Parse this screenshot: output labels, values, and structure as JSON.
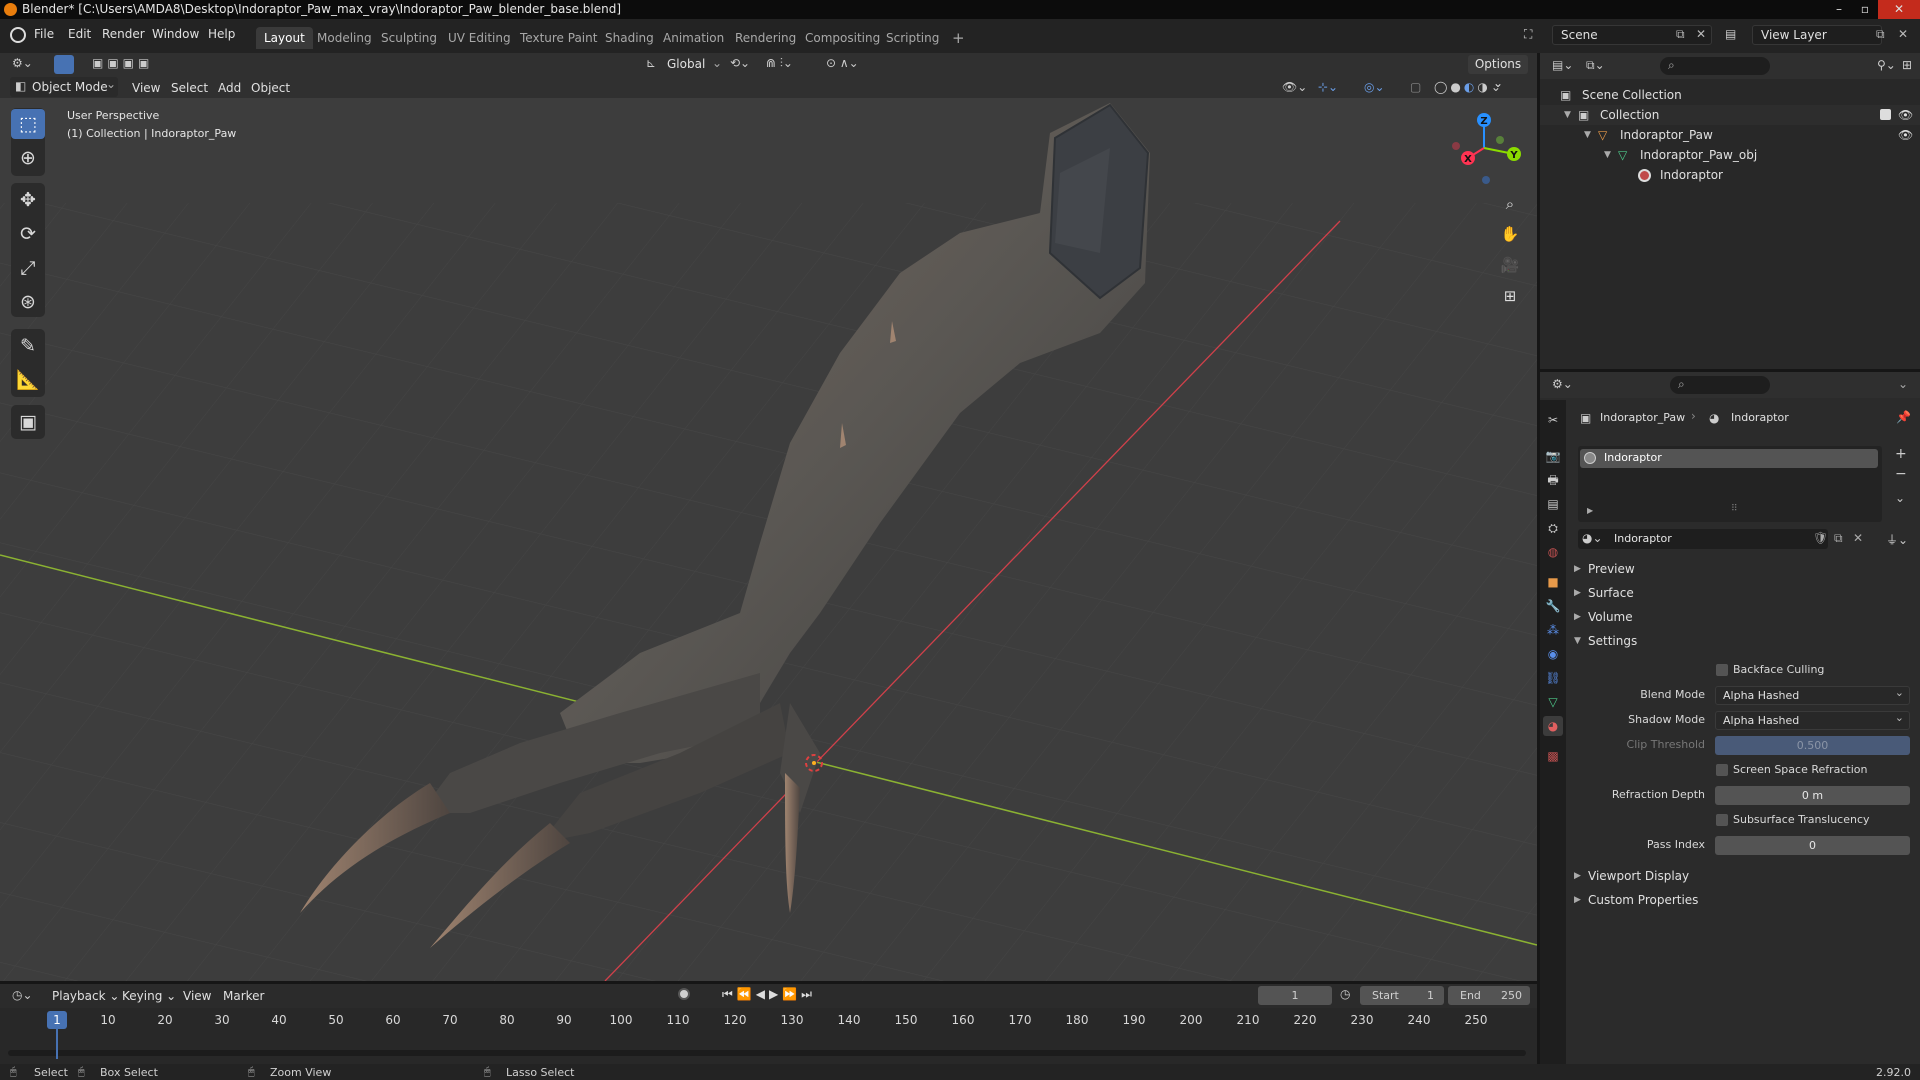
{
  "window": {
    "title": "Blender* [C:\\Users\\AMDA8\\Desktop\\Indoraptor_Paw_max_vray\\Indoraptor_Paw_blender_base.blend]"
  },
  "menu": [
    "File",
    "Edit",
    "Render",
    "Window",
    "Help"
  ],
  "workspaces": [
    "Layout",
    "Modeling",
    "Sculpting",
    "UV Editing",
    "Texture Paint",
    "Shading",
    "Animation",
    "Rendering",
    "Compositing",
    "Scripting"
  ],
  "active_workspace": "Layout",
  "scene": {
    "name": "Scene",
    "view_layer": "View Layer"
  },
  "viewport": {
    "mode": "Object Mode",
    "menus": [
      "View",
      "Select",
      "Add",
      "Object"
    ],
    "transform_orientation": "Global",
    "options_label": "Options",
    "perspective_label": "User Perspective",
    "collection_label": "(1) Collection | Indoraptor_Paw",
    "gizmo_axes": {
      "x": "X",
      "y": "Y",
      "z": "Z"
    }
  },
  "outliner": {
    "rows": [
      "Scene Collection",
      "Collection",
      "Indoraptor_Paw",
      "Indoraptor_Paw_obj",
      "Indoraptor"
    ]
  },
  "properties": {
    "breadcrumb_object": "Indoraptor_Paw",
    "breadcrumb_material": "Indoraptor",
    "slot_name": "Indoraptor",
    "material_name": "Indoraptor",
    "panels": [
      "Preview",
      "Surface",
      "Volume",
      "Settings",
      "Viewport Display",
      "Custom Properties"
    ],
    "settings": {
      "backface_culling_label": "Backface Culling",
      "blend_mode_label": "Blend Mode",
      "blend_mode": "Alpha Hashed",
      "shadow_mode_label": "Shadow Mode",
      "shadow_mode": "Alpha Hashed",
      "clip_threshold_label": "Clip Threshold",
      "clip_threshold": "0.500",
      "ssr_label": "Screen Space Refraction",
      "refraction_depth_label": "Refraction Depth",
      "refraction_depth": "0 m",
      "subsurface_label": "Subsurface Translucency",
      "pass_index_label": "Pass Index",
      "pass_index": "0"
    }
  },
  "timeline": {
    "menus": [
      "Playback",
      "Keying",
      "View",
      "Marker"
    ],
    "current_frame": "1",
    "start_label": "Start",
    "start": "1",
    "end_label": "End",
    "end": "250",
    "ticks": [
      "1",
      "10",
      "20",
      "30",
      "40",
      "50",
      "60",
      "70",
      "80",
      "90",
      "100",
      "110",
      "120",
      "130",
      "140",
      "150",
      "160",
      "170",
      "180",
      "190",
      "200",
      "210",
      "220",
      "230",
      "240",
      "250"
    ]
  },
  "status": {
    "select": "Select",
    "box_select": "Box Select",
    "zoom_view": "Zoom View",
    "lasso_select": "Lasso Select",
    "version": "2.92.0"
  },
  "colors": {
    "accent": "#4772b3",
    "x_axis": "#ff3352",
    "y_axis": "#8bdc00",
    "z_axis": "#2890ff"
  }
}
